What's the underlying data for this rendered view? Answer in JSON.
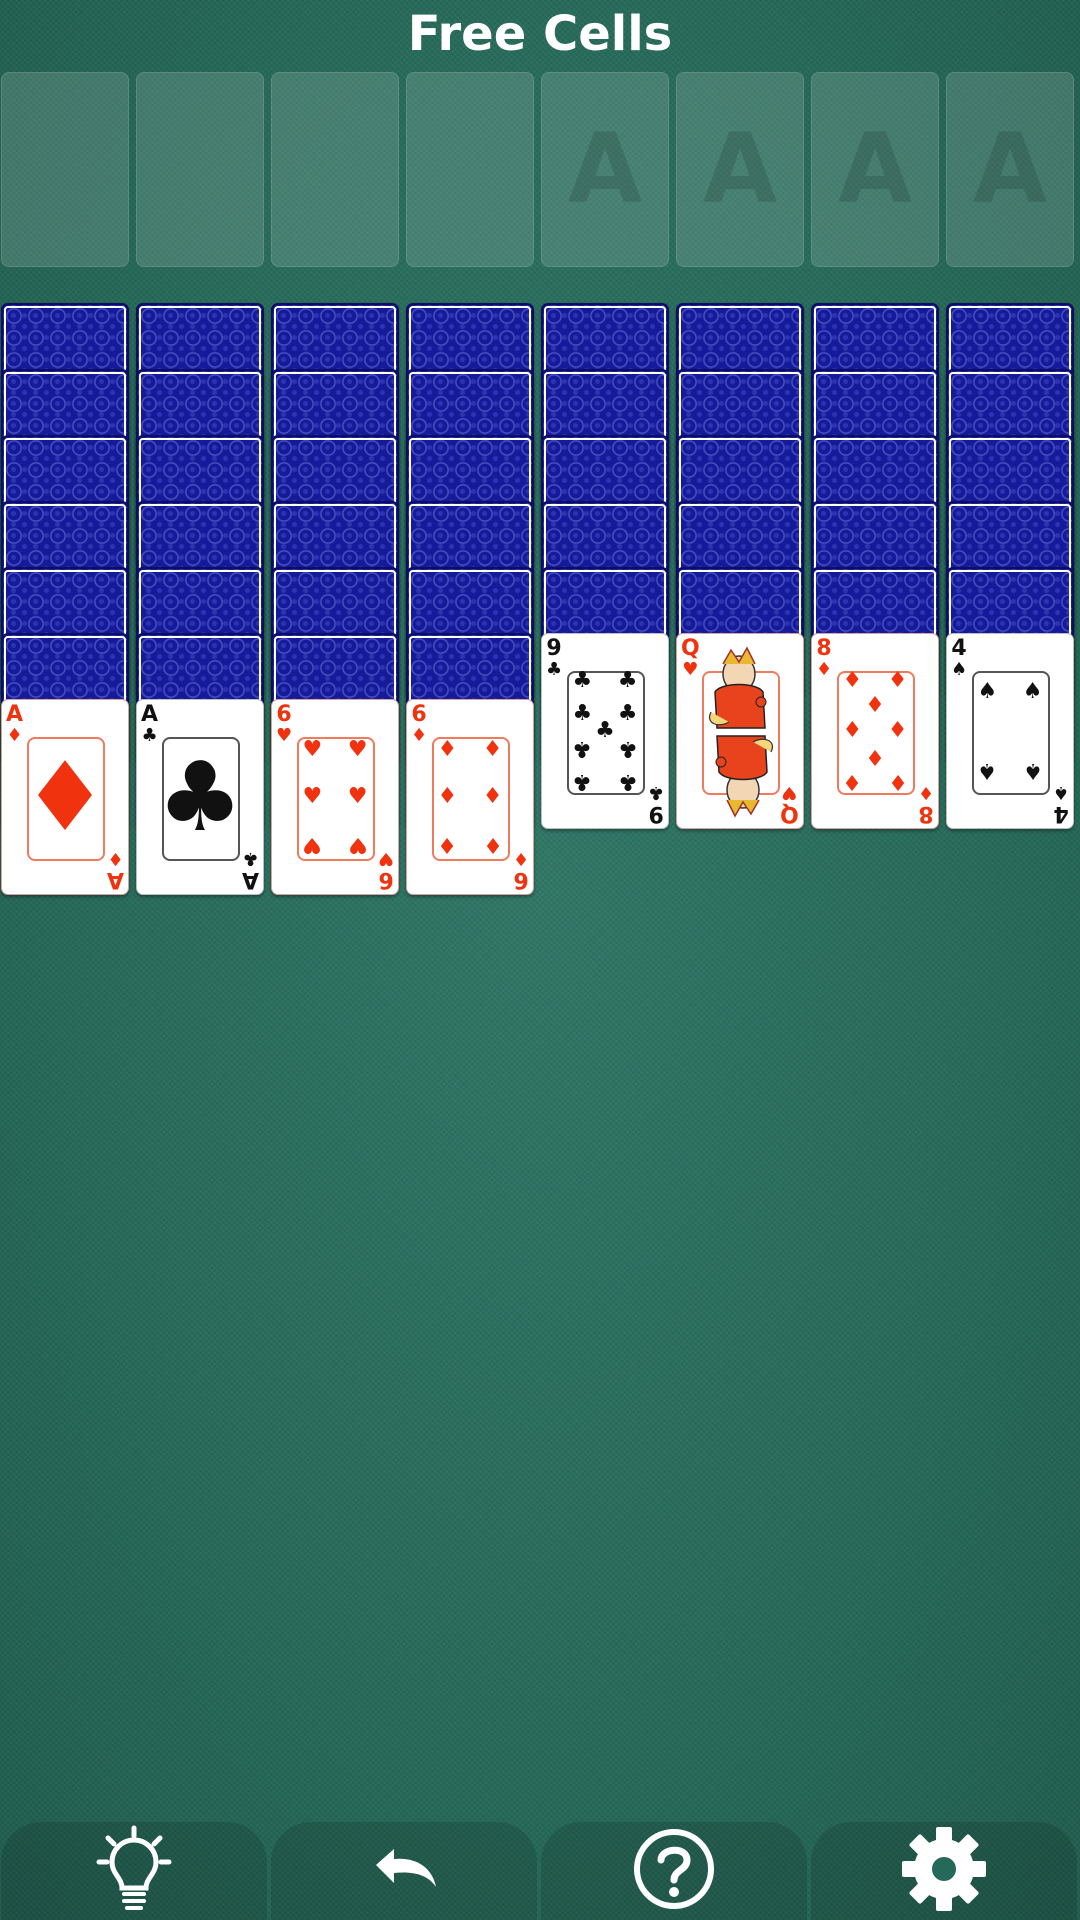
{
  "title": "Free Cells",
  "free_cells": [
    {
      "label": ""
    },
    {
      "label": ""
    },
    {
      "label": ""
    },
    {
      "label": ""
    }
  ],
  "foundations": [
    {
      "placeholder": "A"
    },
    {
      "placeholder": "A"
    },
    {
      "placeholder": "A"
    },
    {
      "placeholder": "A"
    }
  ],
  "tableau": [
    {
      "face_down": 6,
      "face_up": [
        {
          "rank": "A",
          "suit": "diamonds",
          "symbol": "♦",
          "color": "red"
        }
      ]
    },
    {
      "face_down": 6,
      "face_up": [
        {
          "rank": "A",
          "suit": "clubs",
          "symbol": "♣",
          "color": "black"
        }
      ]
    },
    {
      "face_down": 6,
      "face_up": [
        {
          "rank": "6",
          "suit": "hearts",
          "symbol": "♥",
          "color": "red"
        }
      ]
    },
    {
      "face_down": 6,
      "face_up": [
        {
          "rank": "6",
          "suit": "diamonds",
          "symbol": "♦",
          "color": "red"
        }
      ]
    },
    {
      "face_down": 5,
      "face_up": [
        {
          "rank": "9",
          "suit": "clubs",
          "symbol": "♣",
          "color": "black"
        }
      ]
    },
    {
      "face_down": 5,
      "face_up": [
        {
          "rank": "Q",
          "suit": "hearts",
          "symbol": "♥",
          "color": "red"
        }
      ]
    },
    {
      "face_down": 5,
      "face_up": [
        {
          "rank": "8",
          "suit": "diamonds",
          "symbol": "♦",
          "color": "red"
        }
      ]
    },
    {
      "face_down": 5,
      "face_up": [
        {
          "rank": "4",
          "suit": "spades",
          "symbol": "♠",
          "color": "black"
        }
      ]
    }
  ],
  "toolbar": [
    {
      "icon": "lightbulb-icon",
      "name": "hint-button"
    },
    {
      "icon": "undo-icon",
      "name": "undo-button"
    },
    {
      "icon": "help-icon",
      "name": "help-button"
    },
    {
      "icon": "gear-icon",
      "name": "settings-button"
    }
  ],
  "colors": {
    "felt": "#266a59",
    "card_back": "#151a9a",
    "red_suit": "#f0320f"
  }
}
